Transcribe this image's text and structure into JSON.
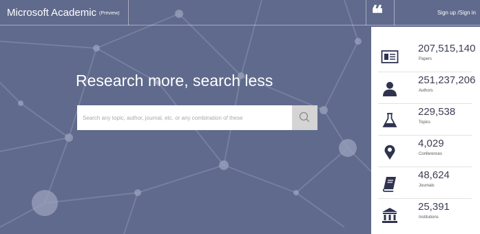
{
  "header": {
    "brand": "Microsoft Academic",
    "preview_tag": "(Preview)",
    "quote_icon": "quote-icon",
    "signin_label": "Sign up /Sign in"
  },
  "hero": {
    "headline": "Research more, search less",
    "search_placeholder": "Search any topic, author, journal, etc. or any combination of these",
    "search_icon": "search-icon"
  },
  "stats": [
    {
      "value": "207,515,140",
      "label": "Papers",
      "icon": "paper-icon"
    },
    {
      "value": "251,237,206",
      "label": "Authors",
      "icon": "person-icon"
    },
    {
      "value": "229,538",
      "label": "Topics",
      "icon": "flask-icon"
    },
    {
      "value": "4,029",
      "label": "Conferences",
      "icon": "location-pin-icon"
    },
    {
      "value": "48,624",
      "label": "Journals",
      "icon": "journal-icon"
    },
    {
      "value": "25,391",
      "label": "Institutions",
      "icon": "institution-icon"
    }
  ],
  "colors": {
    "hero_background": "#5f6a8c",
    "panel_background": "#ffffff",
    "stat_text": "#3c3f55",
    "icon": "#2f3350",
    "search_button": "#d4d4d4"
  }
}
